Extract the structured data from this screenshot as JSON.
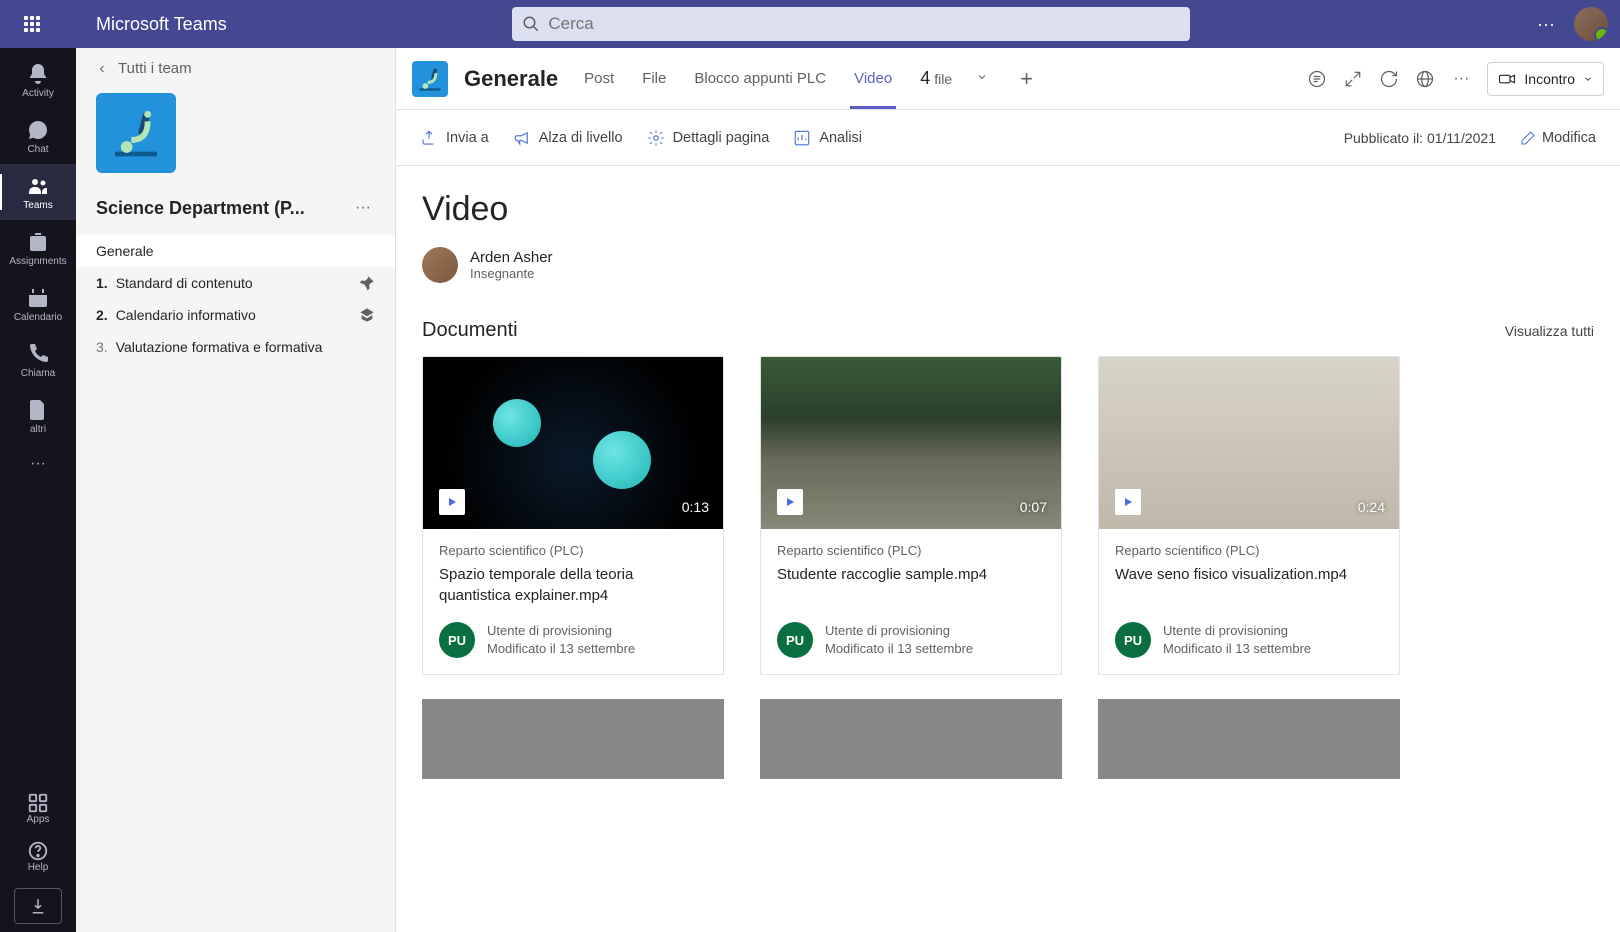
{
  "app": {
    "title": "Microsoft Teams",
    "search_placeholder": "Cerca"
  },
  "rail": {
    "activity": "Activity",
    "chat": "Chat",
    "teams": "Teams",
    "assignments": "Assignments",
    "calendar": "Calendario",
    "calls": "Chiama",
    "files": "altri",
    "apps": "Apps",
    "help": "Help"
  },
  "sidebar": {
    "back_label": "Tutti i team",
    "team_name": "Science Department (P...",
    "channels": [
      {
        "label": "Generale"
      },
      {
        "num": "1.",
        "label": "Standard di contenuto"
      },
      {
        "num": "2.",
        "label": "Calendario informativo"
      },
      {
        "num": "3.",
        "label": "Valutazione formativa e formativa"
      }
    ]
  },
  "tabs": {
    "channel_title": "Generale",
    "post": "Post",
    "file": "File",
    "plc": "Blocco appunti PLC",
    "video": "Video",
    "count_n": "4",
    "count_label": "file",
    "meet": "Incontro"
  },
  "subcmd": {
    "send": "Invia a",
    "promote": "Alza di livello",
    "details": "Dettagli pagina",
    "analytics": "Analisi",
    "published_prefix": "Pubblicato il: ",
    "published_date": "01/11/2021",
    "edit": "Modifica"
  },
  "page": {
    "title": "Video",
    "author_name": "Arden Asher",
    "author_role": "Insegnante",
    "section_title": "Documenti",
    "view_all": "Visualizza tutti"
  },
  "cards": [
    {
      "duration": "0:13",
      "dept": "Reparto scientifico (PLC)",
      "title": "Spazio temporale della teoria quantistica explainer.mp4",
      "user": "Utente di provisioning",
      "modified": "Modificato il 13 settembre",
      "badge": "PU"
    },
    {
      "duration": "0:07",
      "dept": "Reparto scientifico (PLC)",
      "title": "Studente raccoglie sample.mp4",
      "user": "Utente di provisioning",
      "modified": "Modificato il 13 settembre",
      "badge": "PU"
    },
    {
      "duration": "0:24",
      "dept": "Reparto scientifico (PLC)",
      "title": "Wave seno fisico visualization.mp4",
      "user": "Utente di provisioning",
      "modified": "Modificato il 13 settembre",
      "badge": "PU"
    }
  ]
}
